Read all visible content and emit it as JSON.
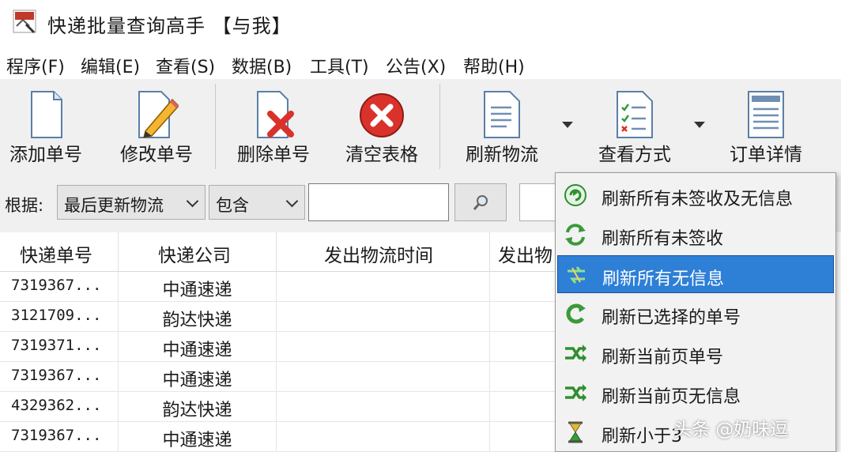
{
  "window": {
    "title": "快递批量查询高手 【与我】"
  },
  "menu": [
    "程序(F)",
    "编辑(E)",
    "查看(S)",
    "数据(B)",
    "工具(T)",
    "公告(X)",
    "帮助(H)"
  ],
  "toolbar": {
    "add": "添加单号",
    "edit": "修改单号",
    "delete": "删除单号",
    "clear": "清空表格",
    "refresh": "刷新物流",
    "view_mode": "查看方式",
    "order_detail": "订单详情"
  },
  "filter": {
    "label": "根据:",
    "field_select": "最后更新物流",
    "match_select": "包含",
    "search_value": ""
  },
  "table": {
    "columns": [
      "快递单号",
      "快递公司",
      "发出物流时间",
      "发出物"
    ],
    "rows": [
      {
        "number": "7319367...",
        "company": "中通速递"
      },
      {
        "number": "3121709...",
        "company": "韵达快递"
      },
      {
        "number": "7319371...",
        "company": "中通速递"
      },
      {
        "number": "7319367...",
        "company": "中通速递"
      },
      {
        "number": "4329362...",
        "company": "韵达快递"
      },
      {
        "number": "7319367...",
        "company": "中通速递"
      }
    ]
  },
  "refresh_menu": {
    "items": [
      {
        "label": "刷新所有未签收及无信息",
        "icon": "refresh-all-icon"
      },
      {
        "label": "刷新所有未签收",
        "icon": "refresh-unsigned-icon"
      },
      {
        "label": "刷新所有无信息",
        "icon": "refresh-noinfo-icon"
      },
      {
        "label": "刷新已选择的单号",
        "icon": "refresh-selected-icon"
      },
      {
        "label": "刷新当前页单号",
        "icon": "refresh-page-icon"
      },
      {
        "label": "刷新当前页无信息",
        "icon": "refresh-page-noinfo-icon"
      },
      {
        "label": "刷新小于3",
        "icon": "hourglass-icon"
      }
    ],
    "selected_index": 2
  },
  "watermark": "头条 @奶味逗",
  "colors": {
    "selection": "#2e7fd6",
    "toolbar_bg": "#f0f0f0",
    "delete_red": "#d9322b",
    "refresh_green": "#3a9a3a"
  }
}
